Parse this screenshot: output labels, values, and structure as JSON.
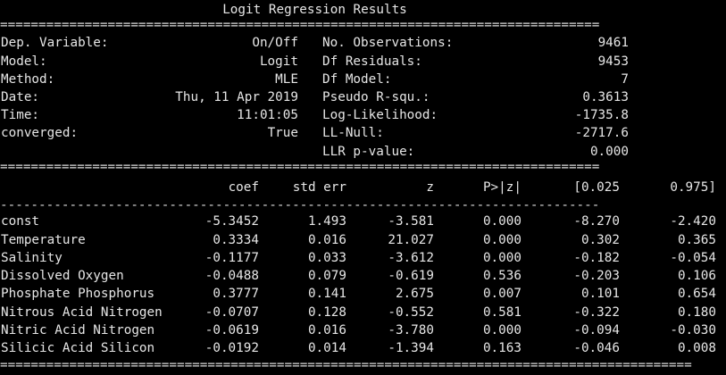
{
  "title": "Logit Regression Results",
  "rules": {
    "top_eq": "==============================================================================",
    "mid_eq": "==============================================================================",
    "dash": "------------------------------------------------------------------------------",
    "bot_eq": "=========================================================================================="
  },
  "summary": [
    {
      "label": "Dep. Variable:",
      "value": "On/Off",
      "label2": "No. Observations:",
      "value2": "9461"
    },
    {
      "label": "Model:",
      "value": "Logit",
      "label2": "Df Residuals:",
      "value2": "9453"
    },
    {
      "label": "Method:",
      "value": "MLE",
      "label2": "Df Model:",
      "value2": "7"
    },
    {
      "label": "Date:",
      "value": "Thu, 11 Apr 2019",
      "label2": "Pseudo R-squ.:",
      "value2": "0.3613"
    },
    {
      "label": "Time:",
      "value": "11:01:05",
      "label2": "Log-Likelihood:",
      "value2": "-1735.8"
    },
    {
      "label": "converged:",
      "value": "True",
      "label2": "LL-Null:",
      "value2": "-2717.6"
    },
    {
      "label": "",
      "value": "",
      "label2": "LLR p-value:",
      "value2": "0.000"
    }
  ],
  "coef_headers": [
    "coef",
    "std err",
    "z",
    "P>|z|",
    "[0.025",
    "0.975]"
  ],
  "coef_rows": [
    [
      "const",
      "-5.3452",
      "1.493",
      "-3.581",
      "0.000",
      "-8.270",
      "-2.420"
    ],
    [
      "Temperature",
      "0.3334",
      "0.016",
      "21.027",
      "0.000",
      "0.302",
      "0.365"
    ],
    [
      "Salinity",
      "-0.1177",
      "0.033",
      "-3.612",
      "0.000",
      "-0.182",
      "-0.054"
    ],
    [
      "Dissolved Oxygen",
      "-0.0488",
      "0.079",
      "-0.619",
      "0.536",
      "-0.203",
      "0.106"
    ],
    [
      "Phosphate Phosphorus",
      "0.3777",
      "0.141",
      "2.675",
      "0.007",
      "0.101",
      "0.654"
    ],
    [
      "Nitrous Acid Nitrogen",
      "-0.0707",
      "0.128",
      "-0.552",
      "0.581",
      "-0.322",
      "0.180"
    ],
    [
      "Nitric Acid Nitrogen",
      "-0.0619",
      "0.016",
      "-3.780",
      "0.000",
      "-0.094",
      "-0.030"
    ],
    [
      "Silicic Acid Silicon",
      "-0.0192",
      "0.014",
      "-1.394",
      "0.163",
      "-0.046",
      "0.008"
    ]
  ]
}
